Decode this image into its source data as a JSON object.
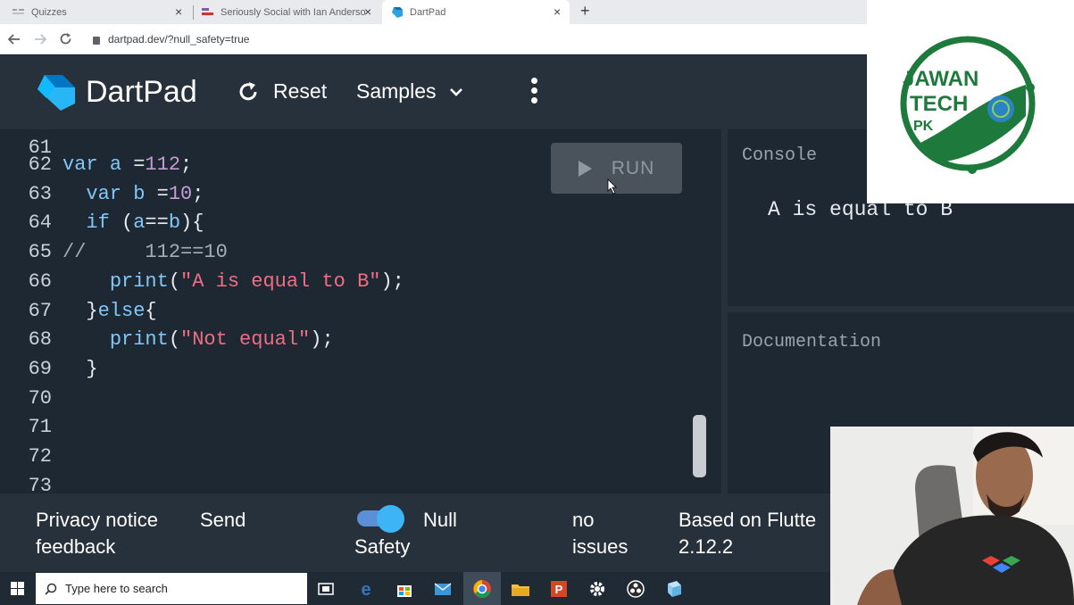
{
  "browser": {
    "tabs": [
      {
        "title": "Quizzes"
      },
      {
        "title": "Seriously Social with Ian Anderso"
      },
      {
        "title": "DartPad"
      }
    ],
    "close_glyph": "×",
    "new_tab_glyph": "+",
    "url": "dartpad.dev/?null_safety=true"
  },
  "header": {
    "app_title": "DartPad",
    "reset_label": "Reset",
    "samples_label": "Samples"
  },
  "editor": {
    "partial_top_line": "61",
    "lines": [
      {
        "n": "62",
        "indent": "",
        "tokens": [
          [
            "kw",
            "var"
          ],
          [
            "p",
            " "
          ],
          [
            "var",
            "a"
          ],
          [
            "p",
            " ="
          ],
          [
            "num",
            "112"
          ],
          [
            "p",
            ";"
          ]
        ]
      },
      {
        "n": "63",
        "indent": "  ",
        "tokens": [
          [
            "kw",
            "var"
          ],
          [
            "p",
            " "
          ],
          [
            "var",
            "b"
          ],
          [
            "p",
            " ="
          ],
          [
            "num",
            "10"
          ],
          [
            "p",
            ";"
          ]
        ]
      },
      {
        "n": "64",
        "indent": "  ",
        "tokens": [
          [
            "kw",
            "if"
          ],
          [
            "p",
            " ("
          ],
          [
            "var",
            "a"
          ],
          [
            "p",
            "=="
          ],
          [
            "var",
            "b"
          ],
          [
            "p",
            "){"
          ]
        ]
      },
      {
        "n": "65",
        "indent": "",
        "tokens": [
          [
            "cmt",
            "//     112==10"
          ]
        ]
      },
      {
        "n": "66",
        "indent": "    ",
        "tokens": [
          [
            "fn",
            "print"
          ],
          [
            "p",
            "("
          ],
          [
            "str",
            "\"A is equal to B\""
          ],
          [
            "p",
            ");"
          ]
        ]
      },
      {
        "n": "67",
        "indent": "  ",
        "tokens": [
          [
            "p",
            "}"
          ],
          [
            "kw",
            "else"
          ],
          [
            "p",
            "{"
          ]
        ]
      },
      {
        "n": "68",
        "indent": "    ",
        "tokens": [
          [
            "fn",
            "print"
          ],
          [
            "p",
            "("
          ],
          [
            "str",
            "\"Not equal\""
          ],
          [
            "p",
            ");"
          ]
        ]
      },
      {
        "n": "69",
        "indent": "  ",
        "tokens": [
          [
            "p",
            "}"
          ]
        ]
      },
      {
        "n": "70",
        "indent": "",
        "tokens": []
      },
      {
        "n": "71",
        "indent": "",
        "tokens": []
      },
      {
        "n": "72",
        "indent": "",
        "tokens": []
      },
      {
        "n": "73",
        "indent": "",
        "tokens": []
      }
    ],
    "run_label": "RUN"
  },
  "console": {
    "label": "Console",
    "output": "A is equal to B"
  },
  "docs": {
    "label": "Documentation"
  },
  "footer": {
    "privacy_notice": "Privacy notice",
    "send_label": "Send",
    "feedback_label": "feedback",
    "null_safety_label_1": "Null",
    "null_safety_label_2": "Safety",
    "null_safety_enabled": true,
    "issues_line_1": "no",
    "issues_line_2": "issues",
    "based_on_line_1": "Based on Flutte",
    "based_on_line_2": "2.12.2"
  },
  "taskbar": {
    "search_placeholder": "Type here to search"
  },
  "logo_overlay": {
    "line1": "JAWAN",
    "line2": "TECH",
    "line3": "PK",
    "brand_color": "#1e7a3c"
  },
  "colors": {
    "header_bg": "#27313c",
    "editor_bg": "#1d2833",
    "accent_blue": "#3db5f5",
    "string_color": "#ef6e84"
  }
}
